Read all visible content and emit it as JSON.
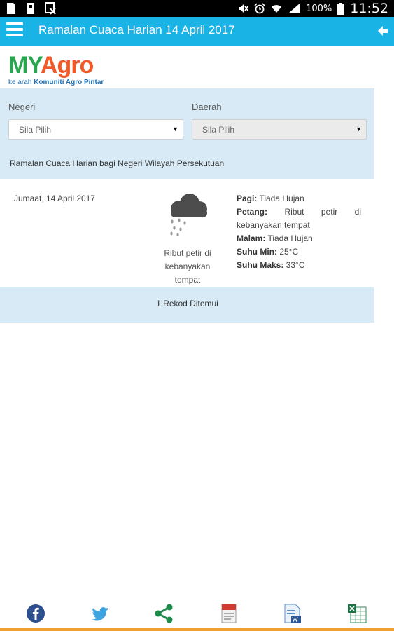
{
  "status_bar": {
    "battery_text": "100%",
    "time": "11:52",
    "left_icons": [
      "document-icon",
      "sd-card-icon",
      "image-x-icon"
    ],
    "right_icons": [
      "mute-icon",
      "alarm-icon",
      "wifi-icon",
      "signal-icon",
      "battery-icon"
    ]
  },
  "app_bar": {
    "title": "Ramalan Cuaca Harian 14 April 2017",
    "color": "#1ab3e6"
  },
  "logo": {
    "my": "MY",
    "agro": "Agro",
    "tag_prefix": "ke arah ",
    "tag_bold": "Komuniti Agro Pintar"
  },
  "filters": {
    "negeri_label": "Negeri",
    "negeri_value": "Sila Pilih",
    "daerah_label": "Daerah",
    "daerah_value": "Sila Pilih",
    "description": "Ramalan Cuaca Harian bagi Negeri Wilayah Persekutuan"
  },
  "forecast": {
    "date": "Jumaat, 14 April 2017",
    "condition": "Ribut petir di kebanyakan tempat",
    "icon": "thunderstorm-cloud-icon",
    "pagi_label": "Pagi:",
    "pagi_value": " Tiada Hujan",
    "petang_label": "Petang:",
    "petang_value": " Ribut petir di kebanyakan tempat",
    "malam_label": "Malam:",
    "malam_value": " Tiada Hujan",
    "suhu_min_label": "Suhu Min:",
    "suhu_min_value": " 25°C",
    "suhu_maks_label": "Suhu Maks:",
    "suhu_maks_value": " 33°C"
  },
  "records": {
    "text": "1 Rekod Ditemui"
  },
  "bottom_bar": {
    "items": [
      "facebook-icon",
      "twitter-icon",
      "share-icon",
      "pdf-icon",
      "word-icon",
      "excel-icon"
    ]
  }
}
